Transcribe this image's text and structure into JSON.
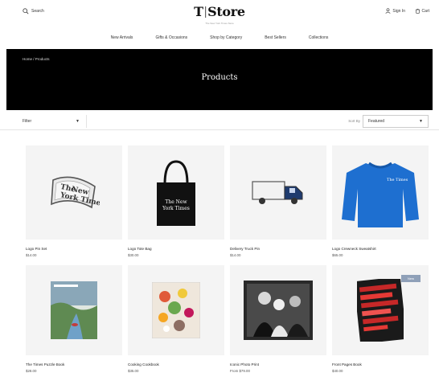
{
  "header": {
    "search_label": "Search",
    "brand_mark": "T",
    "brand_name": "Store",
    "tagline": "The New York Times Store",
    "account_label": "Sign In",
    "cart_label": "Cart"
  },
  "nav": {
    "items": [
      {
        "label": "New Arrivals"
      },
      {
        "label": "Gifts & Occasions"
      },
      {
        "label": "Shop by Category"
      },
      {
        "label": "Best Sellers"
      },
      {
        "label": "Collections"
      }
    ]
  },
  "hero": {
    "breadcrumb": "Home / Products",
    "title": "Products"
  },
  "filters": {
    "filter_label": "Filter",
    "sort_by_label": "Sort By",
    "sort_value": "Featured"
  },
  "products": [
    {
      "name": "Logo Pin Set",
      "price": "$14.00",
      "icon": "pin-icon"
    },
    {
      "name": "Logo Tote Bag",
      "price": "$30.00",
      "icon": "tote-bag-icon"
    },
    {
      "name": "Delivery Truck Pin",
      "price": "$14.00",
      "icon": "truck-icon"
    },
    {
      "name": "Logo Crewneck Sweatshirt",
      "price": "$65.00",
      "icon": "sweatshirt-icon"
    },
    {
      "name": "The Times Puzzle Book",
      "price": "$28.00",
      "icon": "book-icon"
    },
    {
      "name": "Cooking Cookbook",
      "price": "$35.00",
      "icon": "cookbook-icon"
    },
    {
      "name": "Iconic Photo Print",
      "price": "From $79.00",
      "icon": "photo-icon"
    },
    {
      "name": "Front Pages Book",
      "price": "$40.00",
      "icon": "book-icon",
      "badge": "New"
    }
  ],
  "colors": {
    "hero_bg": "#000000",
    "card_bg": "#f4f4f4",
    "sweatshirt_blue": "#1e6fd0",
    "badge_bg": "#8fa0b8"
  }
}
